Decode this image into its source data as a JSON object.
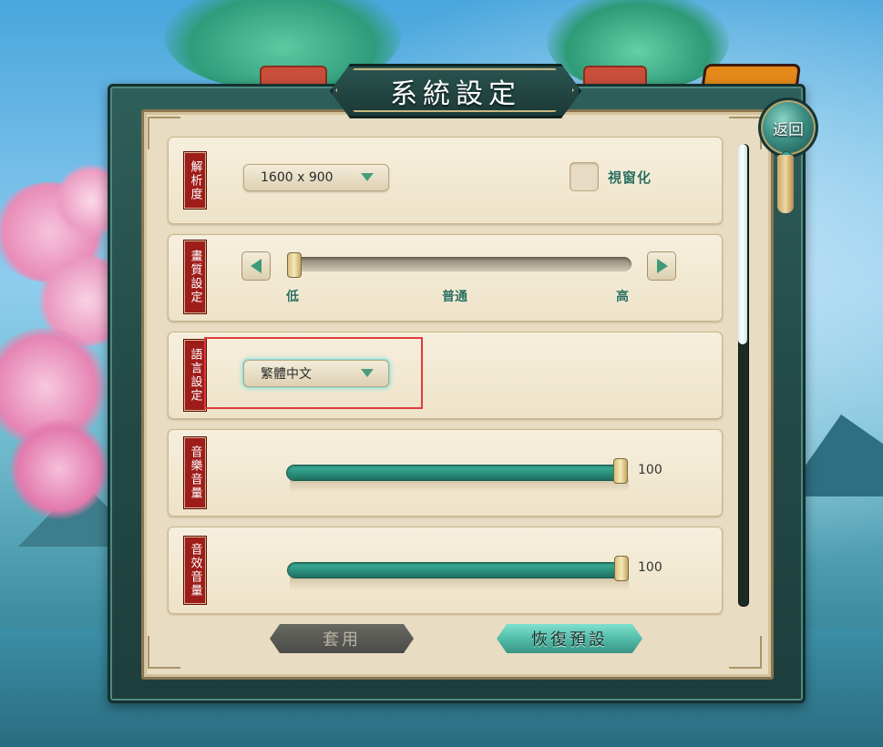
{
  "title": "系統設定",
  "back_button": "返回",
  "resolution": {
    "label": "解析度",
    "value": "1600 x 900",
    "windowed_label": "視窗化",
    "windowed_checked": false
  },
  "quality": {
    "label": "畫質設定",
    "ticks": [
      "低",
      "普通",
      "高"
    ],
    "level": 0
  },
  "language": {
    "label": "語言設定",
    "value": "繁體中文"
  },
  "music": {
    "label": "音樂音量",
    "value": "100",
    "level": 1.0
  },
  "sfx": {
    "label": "音效音量",
    "value": "100",
    "level": 1.0
  },
  "buttons": {
    "apply": "套用",
    "restore": "恢復預設"
  },
  "scrollbar": {
    "position": 0
  },
  "colors": {
    "frame": "#234a47",
    "parchment": "#e8dcc2",
    "label_red": "#9e1d1b",
    "jade_accent": "#3db39c",
    "selection": "#e03b3b"
  }
}
